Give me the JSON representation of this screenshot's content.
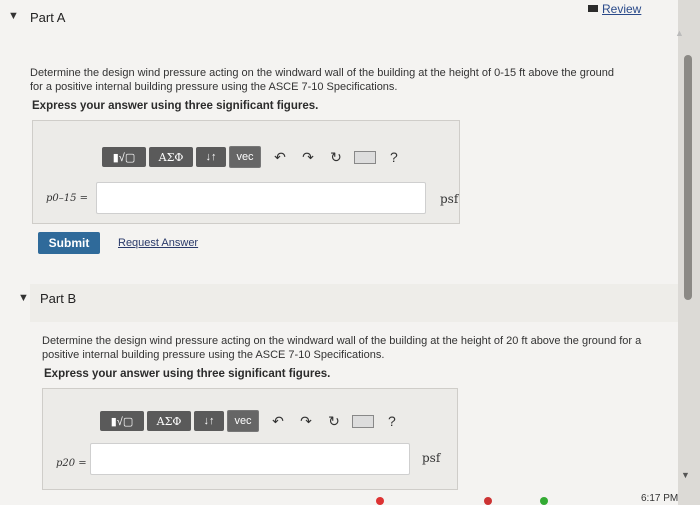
{
  "part_a": {
    "title": "Part A",
    "review_label": "Review",
    "question": "Determine the design wind pressure acting on the windward wall of the building at the height of 0-15 ft above the ground for a positive internal building pressure using the ASCE 7-10 Specifications.",
    "instruction": "Express your answer using three significant figures.",
    "variable_label": "p0–15 =",
    "unit": "psf",
    "submit_label": "Submit",
    "request_answer_label": "Request Answer"
  },
  "part_b": {
    "title": "Part B",
    "question": "Determine the design wind pressure acting on the windward wall of the building at the height of 20 ft above the ground for a positive internal building pressure using the ASCE 7-10 Specifications.",
    "instruction": "Express your answer using three significant figures.",
    "variable_label": "p20 =",
    "unit": "psf"
  },
  "toolbar": {
    "templates_label": "▮√▢",
    "greek_label": "ΑΣΦ",
    "arrows_label": "↓↑",
    "vec_label": "vec",
    "undo_icon": "↶",
    "redo_icon": "↷",
    "reset_icon": "↻",
    "help_label": "?"
  },
  "system": {
    "clock": "6:17 PM"
  }
}
